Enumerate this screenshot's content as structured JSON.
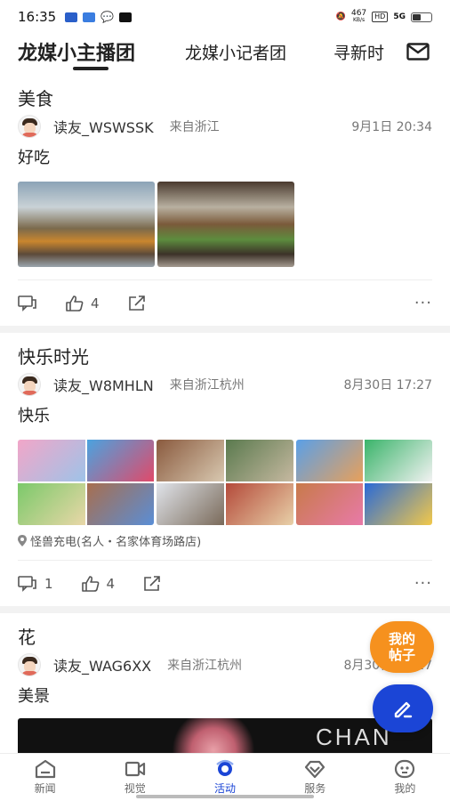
{
  "status_bar": {
    "time": "16:35",
    "net_speed_value": "467",
    "net_speed_unit": "KB/s",
    "hd": "HD",
    "signal": "5G"
  },
  "tabs": [
    {
      "label": "龙媒小主播团",
      "active": true
    },
    {
      "label": "龙媒小记者团",
      "active": false
    },
    {
      "label": "寻新时",
      "active": false
    }
  ],
  "posts": [
    {
      "title": "美食",
      "author": "读友_WSWSSK",
      "from": "来自浙江",
      "date": "9月1日 20:34",
      "body": "好吃",
      "location": "",
      "comments": "",
      "likes": "4"
    },
    {
      "title": "快乐时光",
      "author": "读友_W8MHLN",
      "from": "来自浙江杭州",
      "date": "8月30日 17:27",
      "body": "快乐",
      "location": "怪兽充电(名人・名家体育场路店)",
      "comments": "1",
      "likes": "4"
    },
    {
      "title": "花",
      "author": "读友_WAG6XX",
      "from": "来自浙江杭州",
      "date": "8月30日 17:27",
      "body": "美景",
      "image_text": "CHAN"
    }
  ],
  "fab": {
    "mine_line1": "我的",
    "mine_line2": "帖子"
  },
  "bottom_nav": [
    {
      "label": "新闻",
      "icon": "news-icon"
    },
    {
      "label": "视觉",
      "icon": "video-icon"
    },
    {
      "label": "活动",
      "icon": "activity-icon",
      "active": true
    },
    {
      "label": "服务",
      "icon": "service-icon"
    },
    {
      "label": "我的",
      "icon": "profile-icon"
    }
  ],
  "colors": {
    "accent": "#1b45d6",
    "fab_orange": "#f6911e"
  }
}
